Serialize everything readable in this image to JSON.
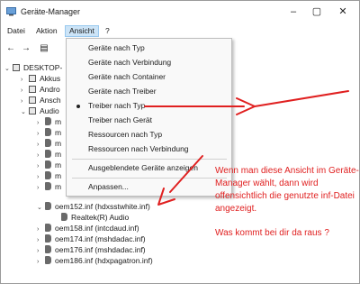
{
  "window": {
    "title": "Geräte-Manager"
  },
  "menubar": [
    {
      "label": "Datei",
      "active": false
    },
    {
      "label": "Aktion",
      "active": false
    },
    {
      "label": "Ansicht",
      "active": true
    },
    {
      "label": "?",
      "active": false
    }
  ],
  "tree": {
    "root": "DESKTOP-",
    "nodes": [
      {
        "label": "Akkus",
        "expander": "›",
        "icon": "dev",
        "level": 1
      },
      {
        "label": "Andro",
        "expander": "›",
        "icon": "dev",
        "level": 1
      },
      {
        "label": "Ansch",
        "expander": "›",
        "icon": "dev",
        "level": 1
      },
      {
        "label": "Audio",
        "expander": "⌄",
        "icon": "dev",
        "level": 1
      },
      {
        "label": "m",
        "expander": "›",
        "icon": "spk",
        "level": 2
      },
      {
        "label": "m",
        "expander": "›",
        "icon": "spk",
        "level": 2
      },
      {
        "label": "m",
        "expander": "›",
        "icon": "spk",
        "level": 2
      },
      {
        "label": "m",
        "expander": "›",
        "icon": "spk",
        "level": 2
      },
      {
        "label": "m",
        "expander": "›",
        "icon": "spk",
        "level": 2
      },
      {
        "label": "m",
        "expander": "›",
        "icon": "spk",
        "level": 2
      },
      {
        "label": "m",
        "expander": "›",
        "icon": "spk",
        "level": 2
      },
      {
        "label": "oem152.inf (hdxsstwhite.inf)",
        "expander": "⌄",
        "icon": "spk",
        "level": 2
      },
      {
        "label": "Realtek(R) Audio",
        "expander": "",
        "icon": "spk",
        "level": 3
      },
      {
        "label": "oem158.inf (intcdaud.inf)",
        "expander": "›",
        "icon": "spk",
        "level": 2
      },
      {
        "label": "oem174.inf (mshdadac.inf)",
        "expander": "›",
        "icon": "spk",
        "level": 2
      },
      {
        "label": "oem176.inf (mshdadac.inf)",
        "expander": "›",
        "icon": "spk",
        "level": 2
      },
      {
        "label": "oem186.inf (hdxpagatron.inf)",
        "expander": "›",
        "icon": "spk",
        "level": 2
      }
    ]
  },
  "dropdown": {
    "items": [
      {
        "label": "Geräte nach Typ",
        "checked": false
      },
      {
        "label": "Geräte nach Verbindung",
        "checked": false
      },
      {
        "label": "Geräte nach Container",
        "checked": false
      },
      {
        "label": "Geräte nach Treiber",
        "checked": false
      },
      {
        "label": "Treiber nach Typ",
        "checked": true
      },
      {
        "label": "Treiber nach Gerät",
        "checked": false
      },
      {
        "label": "Ressourcen nach Typ",
        "checked": false
      },
      {
        "label": "Ressourcen nach Verbindung",
        "checked": false
      },
      {
        "label": "Ausgeblendete Geräte anzeigen",
        "checked": false,
        "separator_before": true
      },
      {
        "label": "Anpassen...",
        "checked": false,
        "separator_before": true
      }
    ]
  },
  "annotation": {
    "text": "Wenn man diese Ansicht im Geräte-Manager wählt, dann wird offensichtlich die genutzte inf-Datei angezeigt.",
    "question": "Was kommt bei dir da raus ?"
  },
  "colors": {
    "annotation": "#e02020",
    "menu_active": "#cce4f7"
  }
}
